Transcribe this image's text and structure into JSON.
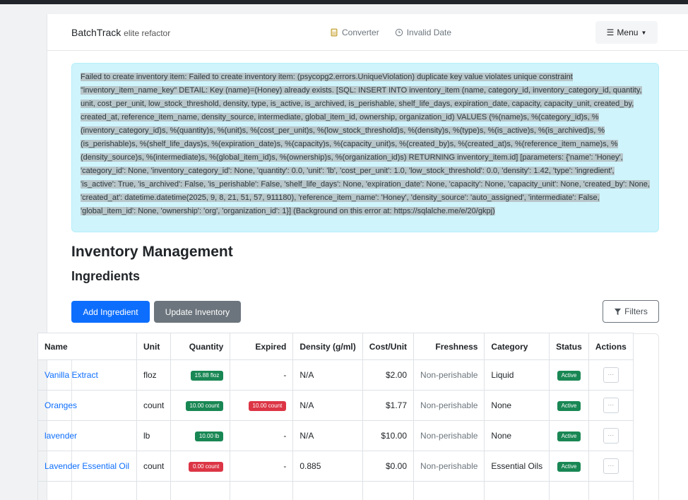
{
  "nav": {
    "brand": "BatchTrack",
    "brand_sub": "elite refactor",
    "links": [
      {
        "label": "Converter",
        "icon": "calculator-icon"
      },
      {
        "label": "Invalid Date",
        "icon": "clock-icon"
      }
    ],
    "menu_label": "Menu"
  },
  "alert": {
    "message": "Failed to create inventory item: Failed to create inventory item: (psycopg2.errors.UniqueViolation) duplicate key value violates unique constraint \"inventory_item_name_key\" DETAIL: Key (name)=(Honey) already exists. [SQL: INSERT INTO inventory_item (name, category_id, inventory_category_id, quantity, unit, cost_per_unit, low_stock_threshold, density, type, is_active, is_archived, is_perishable, shelf_life_days, expiration_date, capacity, capacity_unit, created_by, created_at, reference_item_name, density_source, intermediate, global_item_id, ownership, organization_id) VALUES (%(name)s, %(category_id)s, %(inventory_category_id)s, %(quantity)s, %(unit)s, %(cost_per_unit)s, %(low_stock_threshold)s, %(density)s, %(type)s, %(is_active)s, %(is_archived)s, %(is_perishable)s, %(shelf_life_days)s, %(expiration_date)s, %(capacity)s, %(capacity_unit)s, %(created_by)s, %(created_at)s, %(reference_item_name)s, %(density_source)s, %(intermediate)s, %(global_item_id)s, %(ownership)s, %(organization_id)s) RETURNING inventory_item.id] [parameters: {'name': 'Honey', 'category_id': None, 'inventory_category_id': None, 'quantity': 0.0, 'unit': 'lb', 'cost_per_unit': 1.0, 'low_stock_threshold': 0.0, 'density': 1.42, 'type': 'ingredient', 'is_active': True, 'is_archived': False, 'is_perishable': False, 'shelf_life_days': None, 'expiration_date': None, 'capacity': None, 'capacity_unit': None, 'created_by': None, 'created_at': datetime.datetime(2025, 9, 8, 21, 51, 57, 911180), 'reference_item_name': 'Honey', 'density_source': 'auto_assigned', 'intermediate': False, 'global_item_id': None, 'ownership': 'org', 'organization_id': 1}] (Background on this error at: https://sqlalche.me/e/20/gkpj)"
  },
  "page": {
    "title": "Inventory Management",
    "subtitle": "Ingredients"
  },
  "toolbar": {
    "add_label": "Add Ingredient",
    "update_label": "Update Inventory",
    "filters_label": "Filters"
  },
  "table": {
    "headers": [
      "Name",
      "Unit",
      "Quantity",
      "Expired",
      "Density (g/ml)",
      "Cost/Unit",
      "Freshness",
      "Category",
      "Status",
      "Actions"
    ],
    "rows": [
      {
        "name": "Vanilla Extract",
        "unit": "floz",
        "quantity": "15.88 floz",
        "quantity_color": "#198754",
        "expired": "-",
        "expired_badge": false,
        "density": "N/A",
        "cost": "$2.00",
        "freshness": "Non-perishable",
        "category": "Liquid",
        "status": "Active",
        "actions": "···"
      },
      {
        "name": "Oranges",
        "unit": "count",
        "quantity": "10.00 count",
        "quantity_color": "#198754",
        "expired": "10.00 count",
        "expired_badge": true,
        "density": "N/A",
        "cost": "$1.77",
        "freshness": "Non-perishable",
        "category": "None",
        "status": "Active",
        "actions": "···"
      },
      {
        "name": "lavender",
        "unit": "lb",
        "quantity": "10.00 lb",
        "quantity_color": "#198754",
        "expired": "-",
        "expired_badge": false,
        "density": "N/A",
        "cost": "$10.00",
        "freshness": "Non-perishable",
        "category": "None",
        "status": "Active",
        "actions": "···"
      },
      {
        "name": "Lavender Essential Oil",
        "unit": "count",
        "quantity": "0.00 count",
        "quantity_color": "#dc3545",
        "expired": "-",
        "expired_badge": false,
        "density": "0.885",
        "cost": "$0.00",
        "freshness": "Non-perishable",
        "category": "Essential Oils",
        "status": "Active",
        "actions": "···"
      }
    ]
  }
}
